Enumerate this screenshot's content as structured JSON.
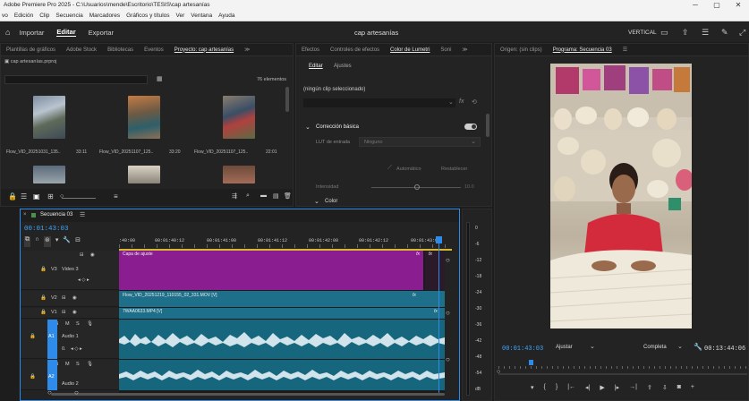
{
  "window": {
    "title": "Adobe Premiere Pro 2025 - C:\\Usuarios\\mende\\Escritorio\\TESIS\\cap artesanías",
    "minimize": "─",
    "maximize": "▢",
    "close": "✕"
  },
  "menubar": [
    "vo",
    "Edición",
    "Clip",
    "Secuencia",
    "Marcadores",
    "Gráficos y títulos",
    "Ver",
    "Ventana",
    "Ayuda"
  ],
  "workspace": {
    "tabs": [
      "Importar",
      "Editar",
      "Exportar"
    ],
    "active_tab": "Editar",
    "project_title": "cap artesanías",
    "layout_label": "VERTICAL"
  },
  "project_panel": {
    "tabs": [
      "Plantillas de gráficos",
      "Adobe Stock",
      "Bibliotecas",
      "Eventos",
      "Proyecto: cap artesanías",
      "≫"
    ],
    "file": "cap artesanías.prproj",
    "count": "76 elementos",
    "clips": [
      {
        "name": "Flow_VID_20251031_135..",
        "duration": "33:11"
      },
      {
        "name": "Flow_VID_20251107_125..",
        "duration": "33:20"
      },
      {
        "name": "Flow_VID_20251107_125..",
        "duration": "22:01"
      }
    ]
  },
  "lumetri_panel": {
    "tabs": [
      "Efectos",
      "Controles de efectos",
      "Color de Lumetri",
      "Soni",
      "≫"
    ],
    "subtabs": [
      "Editar",
      "Ajustes"
    ],
    "no_clip": "(ningún clip seleccionado)",
    "section": "Corrección básica",
    "lut_label": "LUT de entrada",
    "lut_value": "Ninguno",
    "auto_btn": "Automático",
    "reset_btn": "Restablecer",
    "intensity_label": "Intensidad",
    "intensity_value": "10.0",
    "color_label": "Color"
  },
  "program_panel": {
    "source_tab": "Origen: (sin clips)",
    "program_tab": "Programa: Secuencia 03",
    "timecode": "00:01:43:03",
    "fit": "Ajustar",
    "quality": "Completa",
    "duration": "00:13:44:06"
  },
  "timeline": {
    "sequence": "Secuencia 03",
    "timecode": "00:01:43:03",
    "ruler": [
      ":40:00",
      "00:01:40:12",
      "00:01:41:00",
      "00:01:41:12",
      "00:01:42:00",
      "00:01:42:12",
      "00:01:43:00"
    ],
    "tracks": {
      "v3": "V3",
      "v3_name": "Video 3",
      "v2": "V2",
      "v1": "V1",
      "a1": "A1",
      "a1_name": "Audio 1",
      "a1_vol": "0.",
      "a2": "A2",
      "a2_name": "Audio 2"
    },
    "clips": {
      "adjust": "Capa de ajuste",
      "v2_clip": "Flow_VID_20251219_110155_02_331.MOV [V]",
      "v1_clip": "7WAA0633.MP4 [V]"
    },
    "meter_labels": [
      "0",
      "-6",
      "-12",
      "-18",
      "-24",
      "-30",
      "-36",
      "-42",
      "-48",
      "-54",
      "dB"
    ]
  },
  "colors": {
    "accent_blue": "#2e8bea",
    "adjustment_purple": "#8a1d8f",
    "video_teal": "#1e6f89",
    "audio_teal": "#16677e",
    "timecode_blue": "#3fa7ff"
  }
}
